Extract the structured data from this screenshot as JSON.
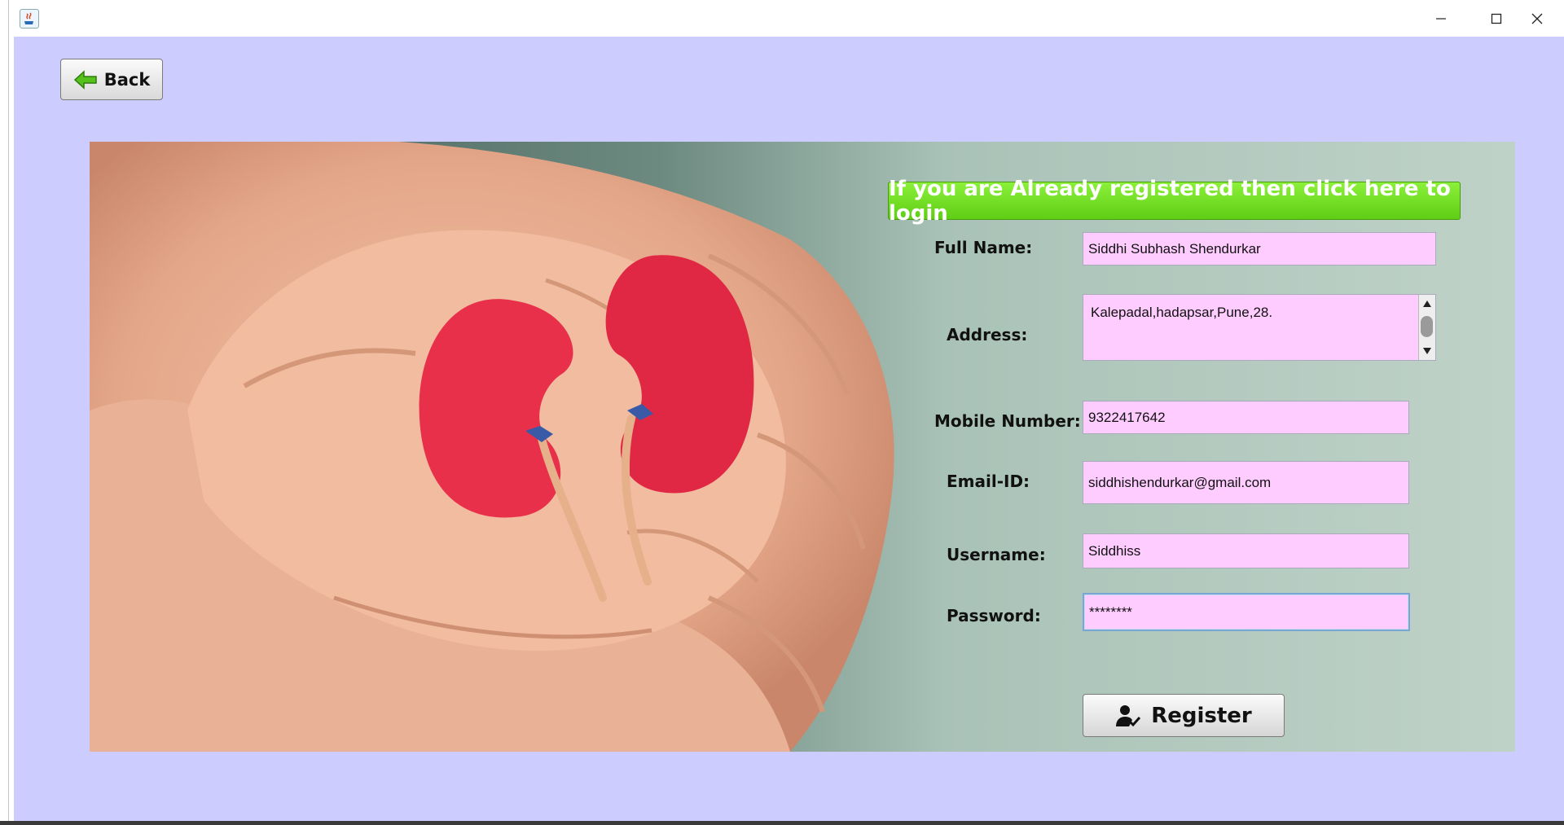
{
  "window": {
    "title_icon": "java-icon",
    "controls": {
      "minimize": "minimize-icon",
      "maximize": "maximize-icon",
      "close": "close-icon"
    }
  },
  "toolbar": {
    "back_label": "Back",
    "back_icon": "arrow-left-icon"
  },
  "banner": {
    "login_text": "If you are Already registered then click here to login"
  },
  "form": {
    "full_name_label": "Full Name:",
    "full_name_value": "Siddhi Subhash Shendurkar",
    "address_label": "Address:",
    "address_value": "Kalepadal,hadapsar,Pune,28.",
    "mobile_label": "Mobile Number:",
    "mobile_value": "9322417642",
    "email_label": "Email-ID:",
    "email_value": "siddhishendurkar@gmail.com",
    "username_label": "Username:",
    "username_value": "Siddhiss",
    "password_label": "Password:",
    "password_value": "********",
    "register_label": "Register",
    "register_icon": "user-check-icon"
  },
  "colors": {
    "background": "#ccccff",
    "field_fill": "#ffccff",
    "banner_green": "#66dd22",
    "kidney_red": "#e8304a"
  }
}
